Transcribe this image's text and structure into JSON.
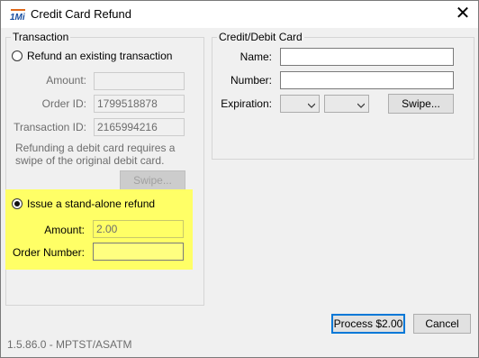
{
  "window": {
    "title": "Credit Card Refund"
  },
  "transaction": {
    "group_label": "Transaction",
    "refund_existing_label": "Refund an existing transaction",
    "amount_label": "Amount:",
    "amount_value": "",
    "order_id_label": "Order ID:",
    "order_id_value": "1799518878",
    "transaction_id_label": "Transaction ID:",
    "transaction_id_value": "2165994216",
    "note_line1": "Refunding a debit card requires a",
    "note_line2": "swipe of the original debit card.",
    "swipe_label": "Swipe...",
    "standalone_label": "Issue a stand-alone refund",
    "standalone_amount_label": "Amount:",
    "standalone_amount_value": "2.00",
    "order_number_label": "Order Number:",
    "order_number_value": ""
  },
  "card": {
    "group_label": "Credit/Debit Card",
    "name_label": "Name:",
    "name_value": "",
    "number_label": "Number:",
    "number_value": "",
    "expiration_label": "Expiration:",
    "swipe_label": "Swipe..."
  },
  "buttons": {
    "process_label": "Process $2.00",
    "cancel_label": "Cancel"
  },
  "footer": {
    "version": "1.5.86.0 - MPTST/ASATM"
  },
  "icons": {
    "app": "app-logo-icon",
    "close": "close-icon"
  },
  "colors": {
    "highlight": "#ffff66",
    "field_highlight": "#ffff80",
    "accent": "#0078d7"
  }
}
